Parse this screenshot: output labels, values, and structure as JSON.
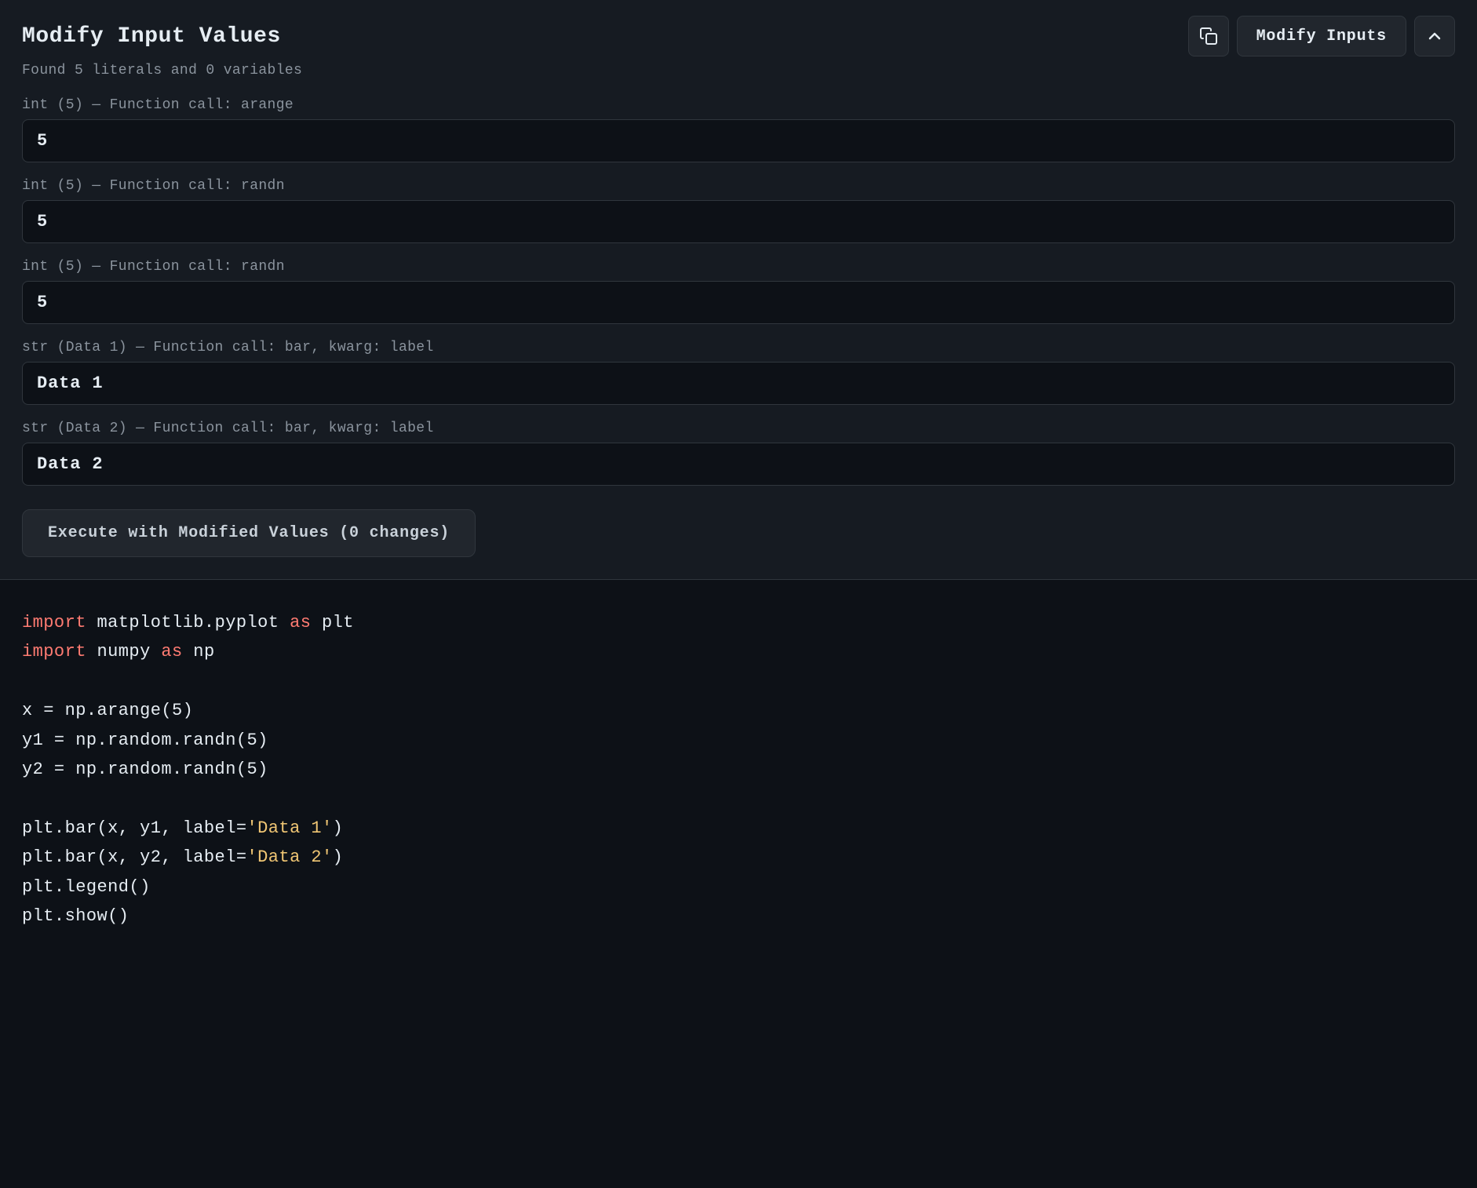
{
  "header": {
    "title": "Modify Input Values",
    "subtitle": "Found 5 literals and 0 variables",
    "modify_inputs_label": "Modify Inputs"
  },
  "inputs": [
    {
      "label": "int (5) — Function call: arange",
      "value": "5",
      "id": "input-arange"
    },
    {
      "label": "int (5) — Function call: randn",
      "value": "5",
      "id": "input-randn-1"
    },
    {
      "label": "int (5) — Function call: randn",
      "value": "5",
      "id": "input-randn-2"
    },
    {
      "label": "str (Data 1) — Function call: bar, kwarg: label",
      "value": "Data 1",
      "id": "input-bar-label-1"
    },
    {
      "label": "str (Data 2) — Function call: bar, kwarg: label",
      "value": "Data 2",
      "id": "input-bar-label-2"
    }
  ],
  "execute_button": {
    "label": "Execute with Modified Values (0 changes)"
  },
  "code": {
    "lines": [
      {
        "type": "import",
        "keyword": "import",
        "module": " matplotlib.pyplot ",
        "as_kw": "as",
        "alias": " plt"
      },
      {
        "type": "import",
        "keyword": "import",
        "module": " numpy ",
        "as_kw": "as",
        "alias": " np"
      },
      {
        "type": "blank"
      },
      {
        "type": "plain",
        "text": "x = np.arange(5)"
      },
      {
        "type": "plain",
        "text": "y1 = np.random.randn(5)"
      },
      {
        "type": "plain",
        "text": "y2 = np.random.randn(5)"
      },
      {
        "type": "blank"
      },
      {
        "type": "bar_call",
        "prefix": "plt.bar(x, y1, label=",
        "string": "'Data 1'",
        "suffix": ")"
      },
      {
        "type": "bar_call",
        "prefix": "plt.bar(x, y2, label=",
        "string": "'Data 2'",
        "suffix": ")"
      },
      {
        "type": "plain",
        "text": "plt.legend()"
      },
      {
        "type": "plain",
        "text": "plt.show()"
      }
    ]
  }
}
